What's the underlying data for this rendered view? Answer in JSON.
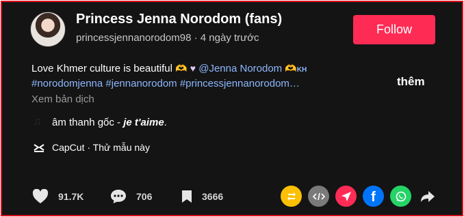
{
  "profile": {
    "name": "Princess Jenna Norodom (fans)",
    "username": "princessjennanorodom98",
    "time": "4 ngày trước"
  },
  "follow_label": "Follow",
  "caption": {
    "text": "Love Khmer culture is beautiful",
    "mention": "@Jenna Norodom",
    "kh_badge": "KH",
    "hashtags": "#norodomjenna #jennanorodom #princessjennanorodom…",
    "more": "thêm",
    "translate": "Xem bản dịch"
  },
  "music": {
    "prefix": "âm thanh gốc - ",
    "title": "je t'aime",
    "suffix": "."
  },
  "template": {
    "name": "CapCut",
    "action": "Thử mẫu này"
  },
  "stats": {
    "likes": "91.7K",
    "comments": "706",
    "saves": "3666"
  },
  "colors": {
    "follow_bg": "#fe2c55",
    "link": "#8eb8ff",
    "border": "#e0101e"
  },
  "share_icons": [
    "repost-icon",
    "embed-icon",
    "send-icon",
    "facebook-icon",
    "whatsapp-icon",
    "share-arrow-icon"
  ]
}
